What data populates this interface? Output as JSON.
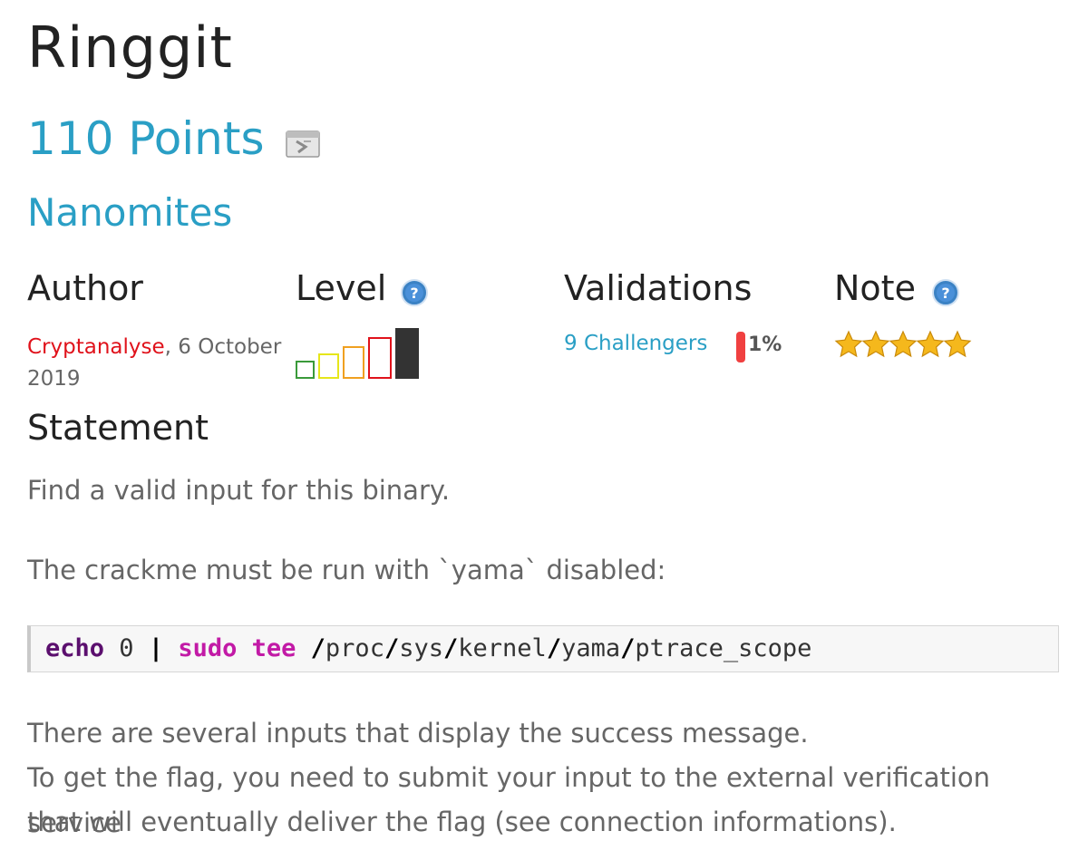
{
  "challenge": {
    "title": "Ringgit",
    "points": "110 Points",
    "category": "Nanomites"
  },
  "columns": {
    "author": "Author",
    "level": "Level",
    "validations": "Validations",
    "note": "Note"
  },
  "author": {
    "name": "Cryptanalyse",
    "date": "6 October 2019"
  },
  "level": {
    "value": 5,
    "max": 5,
    "colors": [
      "#3a9a3a",
      "#e6e61a",
      "#f0a020",
      "#e0121b",
      "#333333"
    ]
  },
  "validations": {
    "challengers": "9 Challengers",
    "percent": "1%",
    "percent_value": 1
  },
  "note": {
    "stars": 5,
    "max": 5
  },
  "statement": {
    "heading": "Statement",
    "line1": "Find a valid input for this binary.",
    "line2": "The crackme must be run with `yama` disabled:",
    "code": {
      "echo": "echo",
      "zero": " 0 ",
      "pipe": "|",
      "sudo": " sudo",
      "tee": " tee",
      "path": [
        "proc",
        "sys",
        "kernel",
        "yama",
        "ptrace_scope"
      ]
    },
    "line3": "There are several inputs that display the success message.",
    "line4": "To get the flag, you need to submit your input to the external verification service",
    "line5": "that will eventually deliver the flag (see connection informations)."
  },
  "icons": {
    "points_icon": "challenge-link-icon",
    "help_icon": "help-icon",
    "star_icon": "star-icon"
  },
  "colors": {
    "accent": "#2a9fc5",
    "author": "#e0121b",
    "percent_bar": "#f04040"
  }
}
